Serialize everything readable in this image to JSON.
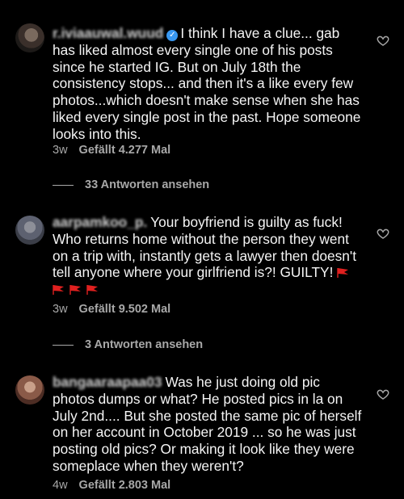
{
  "comments": [
    {
      "username": "r.iviaauwal.wuud",
      "verified": true,
      "text": "I think I have a clue... gab has liked almost every single one of his posts since he started IG. But on July 18th the consistency stops... and then it's a like every few photos...which doesn't make sense when she has liked every single post in the past. Hope someone looks into this.",
      "age": "3w",
      "likes": "Gefällt 4.277 Mal",
      "replies": "33 Antworten ansehen"
    },
    {
      "username": "aarpamkoo_p.",
      "verified": false,
      "text": "Your boyfriend is guilty as fuck! Who returns home without the person they went on a trip with, instantly gets a lawyer then doesn't tell anyone where your girlfriend is?! GUILTY!",
      "emoji": "red-flag x4",
      "age": "3w",
      "likes": "Gefällt 9.502 Mal",
      "replies": "3 Antworten ansehen"
    },
    {
      "username": "bangaaraapaa03",
      "verified": false,
      "text": "Was he just doing old pic photos dumps or what? He posted pics in la on July 2nd.... But she posted the same pic of herself  on her account in October 2019 ... so he was just posting old pics? Or making it look like they were someplace when they weren't?",
      "age": "4w",
      "likes": "Gefällt 2.803 Mal"
    }
  ],
  "colors": {
    "background": "#000000",
    "text": "#f5f5f5",
    "secondary": "#a8a8a8",
    "verified": "#3897f0",
    "flag": "#e0201f"
  }
}
